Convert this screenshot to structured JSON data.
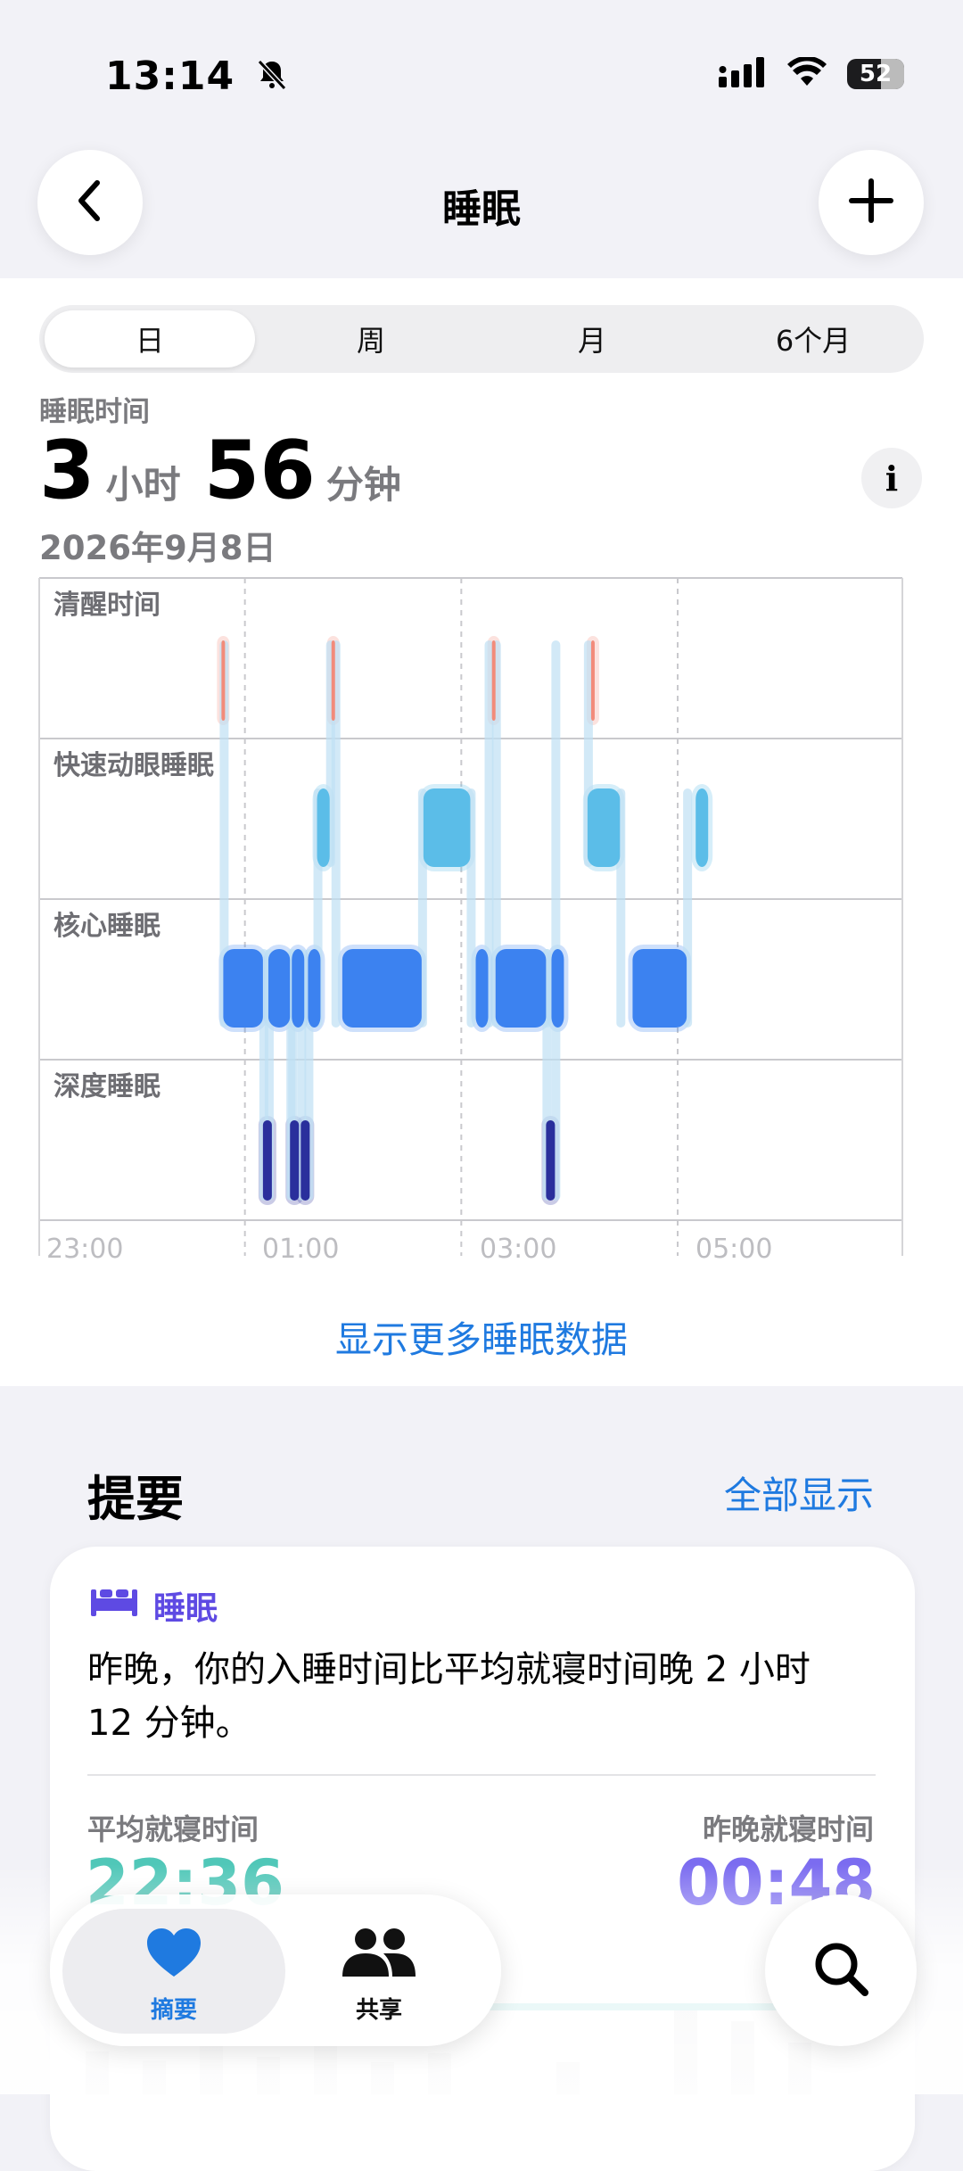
{
  "status_bar": {
    "time": "13:14",
    "battery": "52"
  },
  "nav": {
    "title": "睡眠"
  },
  "segments": [
    "日",
    "周",
    "月",
    "6个月"
  ],
  "selected_segment": "日",
  "metric": {
    "label": "睡眠时间",
    "hours": "3",
    "hours_unit": "小时",
    "minutes": "56",
    "minutes_unit": "分钟",
    "date": "2026年9月8日"
  },
  "chart_data": {
    "type": "sleep-stage-timeline",
    "stages": [
      "清醒时间",
      "快速动眼睡眠",
      "核心睡眠",
      "深度睡眠"
    ],
    "x_ticks": [
      "23:00",
      "01:00",
      "03:00",
      "05:00"
    ],
    "colors": {
      "awake": "#F28B7A",
      "rem": "#5BBDE8",
      "core": "#3C82F0",
      "deep": "#2A2F9C"
    },
    "segments": [
      {
        "stage": "awake",
        "start": "00:47",
        "end": "00:48"
      },
      {
        "stage": "core",
        "start": "00:48",
        "end": "01:10"
      },
      {
        "stage": "deep",
        "start": "01:10",
        "end": "01:13"
      },
      {
        "stage": "core",
        "start": "01:13",
        "end": "01:25"
      },
      {
        "stage": "deep",
        "start": "01:25",
        "end": "01:26"
      },
      {
        "stage": "core",
        "start": "01:26",
        "end": "01:31"
      },
      {
        "stage": "deep",
        "start": "01:31",
        "end": "01:35"
      },
      {
        "stage": "core",
        "start": "01:35",
        "end": "01:40"
      },
      {
        "stage": "rem",
        "start": "01:40",
        "end": "01:47"
      },
      {
        "stage": "awake",
        "start": "01:48",
        "end": "01:49"
      },
      {
        "stage": "core",
        "start": "01:54",
        "end": "02:38"
      },
      {
        "stage": "rem",
        "start": "02:39",
        "end": "03:05"
      },
      {
        "stage": "core",
        "start": "03:08",
        "end": "03:13"
      },
      {
        "stage": "awake",
        "start": "03:17",
        "end": "03:18"
      },
      {
        "stage": "core",
        "start": "03:19",
        "end": "03:47"
      },
      {
        "stage": "core",
        "start": "03:50",
        "end": "03:54"
      },
      {
        "stage": "deep",
        "start": "03:47",
        "end": "03:50"
      },
      {
        "stage": "awake",
        "start": "03:72",
        "end": "03:73"
      },
      {
        "stage": "rem",
        "start": "04:10",
        "end": "04:28"
      },
      {
        "stage": "core",
        "start": "04:35",
        "end": "05:05"
      },
      {
        "stage": "rem",
        "start": "05:10",
        "end": "05:14"
      }
    ]
  },
  "more_link": "显示更多睡眠数据",
  "highlights": {
    "title": "提要",
    "see_all": "全部显示",
    "category": "睡眠",
    "text": "昨晚，你的入睡时间比平均就寝时间晚 2 小时 12 分钟。",
    "avg_label": "平均就寝时间",
    "avg_value": "22:36",
    "last_label": "昨晚就寝时间",
    "last_value": "00:48"
  },
  "tabs": {
    "summary": "摘要",
    "sharing": "共享"
  },
  "icons": [
    "bell-slash-icon",
    "cellular-icon",
    "wifi-icon",
    "battery-icon",
    "back-chevron-icon",
    "plus-icon",
    "info-icon",
    "bed-icon",
    "heart-icon",
    "people-icon",
    "search-icon"
  ]
}
